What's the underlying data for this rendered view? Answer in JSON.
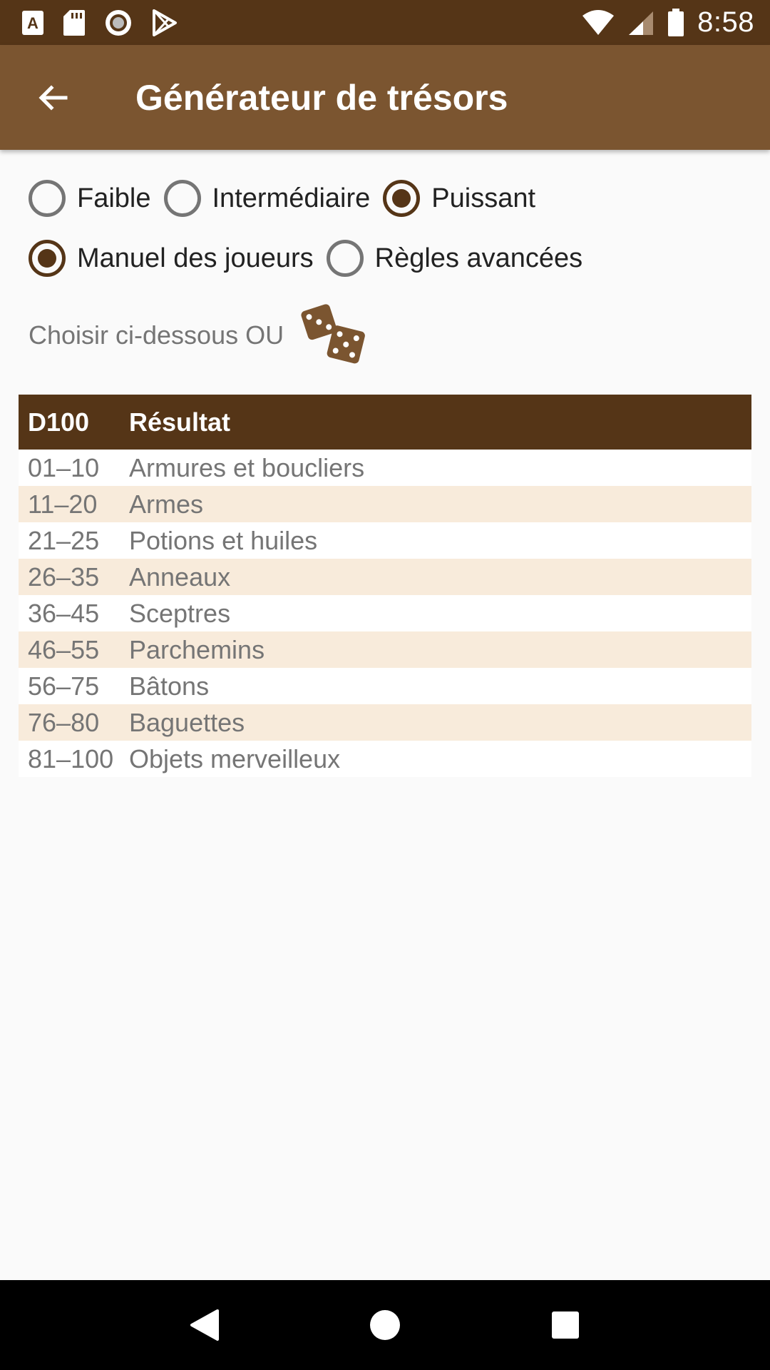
{
  "status_bar": {
    "time": "8:58",
    "left_icons": [
      "font-a-icon",
      "sd-card-icon",
      "record-icon",
      "play-store-icon"
    ],
    "right_icons": [
      "wifi-icon",
      "signal-icon",
      "battery-icon"
    ]
  },
  "app_bar": {
    "title": "Générateur de trésors",
    "back_icon": "arrow-back-icon",
    "color": "#7B5530"
  },
  "power_options": [
    {
      "label": "Faible",
      "checked": false
    },
    {
      "label": "Intermédiaire",
      "checked": false
    },
    {
      "label": "Puissant",
      "checked": true
    }
  ],
  "source_options": [
    {
      "label": "Manuel des joueurs",
      "checked": true
    },
    {
      "label": "Règles avancées",
      "checked": false
    }
  ],
  "choose": {
    "text": "Choisir ci-dessous OU",
    "dice_icon": "dice-icon"
  },
  "table": {
    "headers": [
      "D100",
      "Résultat"
    ],
    "rows": [
      {
        "range": "01–10",
        "result": "Armures et boucliers"
      },
      {
        "range": "11–20",
        "result": "Armes"
      },
      {
        "range": "21–25",
        "result": "Potions et huiles"
      },
      {
        "range": "26–35",
        "result": "Anneaux"
      },
      {
        "range": "36–45",
        "result": "Sceptres"
      },
      {
        "range": "46–55",
        "result": "Parchemins"
      },
      {
        "range": "56–75",
        "result": "Bâtons"
      },
      {
        "range": "76–80",
        "result": "Baguettes"
      },
      {
        "range": "81–100",
        "result": "Objets merveilleux"
      }
    ]
  },
  "colors": {
    "primary_dark": "#553517",
    "primary": "#7B5530",
    "row_alt": "#F8EBDB"
  },
  "nav_bar": {
    "buttons": [
      "back-triangle-icon",
      "home-circle-icon",
      "recents-square-icon"
    ]
  }
}
